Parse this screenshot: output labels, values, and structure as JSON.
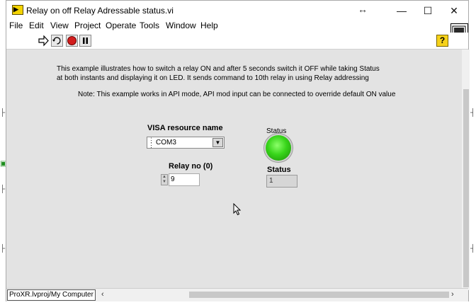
{
  "window": {
    "title": "Relay on off Relay Adressable status.vi",
    "controls": {
      "minimize": "—",
      "maximize": "☐",
      "close": "✕",
      "resize_glyph": "↔"
    }
  },
  "menu": [
    "File",
    "Edit",
    "View",
    "Project",
    "Operate",
    "Tools",
    "Window",
    "Help"
  ],
  "toolbar": {
    "buttons": [
      "run-icon",
      "run-continuously-icon",
      "abort-icon",
      "pause-icon"
    ],
    "help": "?"
  },
  "front_panel": {
    "description_line1": "This example illustrates how to switch a relay ON and after 5 seconds switch it OFF while taking Status",
    "description_line2": "at both instants and displaying it on LED. It sends command to 10th relay in using Relay addressing",
    "note": "Note: This example works in API mode, API mod input can be connected to override default ON value",
    "visa": {
      "label": "VISA resource name",
      "value": "COM3"
    },
    "relay_no": {
      "label": "Relay no (0)",
      "value": "9"
    },
    "led": {
      "label": "Status",
      "state": "on",
      "color": "#38d51a"
    },
    "status_indicator": {
      "label": "Status",
      "value": "1"
    }
  },
  "statusbar": {
    "path": "ProXR.lvproj/My Computer"
  }
}
